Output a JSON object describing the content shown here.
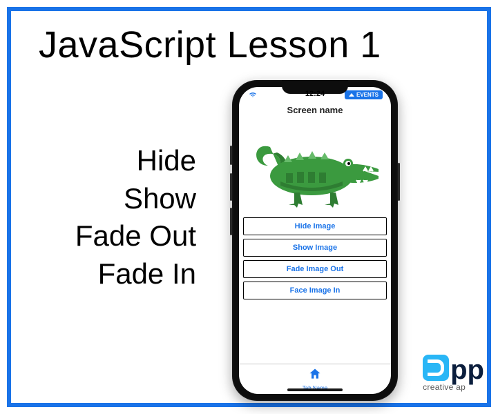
{
  "title": "JavaScript Lesson 1",
  "actions": [
    "Hide",
    "Show",
    "Fade Out",
    "Fade In"
  ],
  "phone": {
    "clock": "12:24",
    "events_label": "EVENTS",
    "screen_title": "Screen name",
    "buttons": [
      "Hide Image",
      "Show Image",
      "Fade Image Out",
      "Face Image In"
    ],
    "tab_label": "Tab Name"
  },
  "brand": {
    "letters": "pp",
    "tagline": "creative ap"
  },
  "icons": {
    "home": "home-icon",
    "crocodile": "crocodile-image"
  },
  "colors": {
    "frame": "#1a73e8",
    "link": "#1a73e8",
    "croc_dark": "#2e7d32",
    "croc_light": "#66bb6a",
    "logo_tile": "#29b6f6"
  }
}
